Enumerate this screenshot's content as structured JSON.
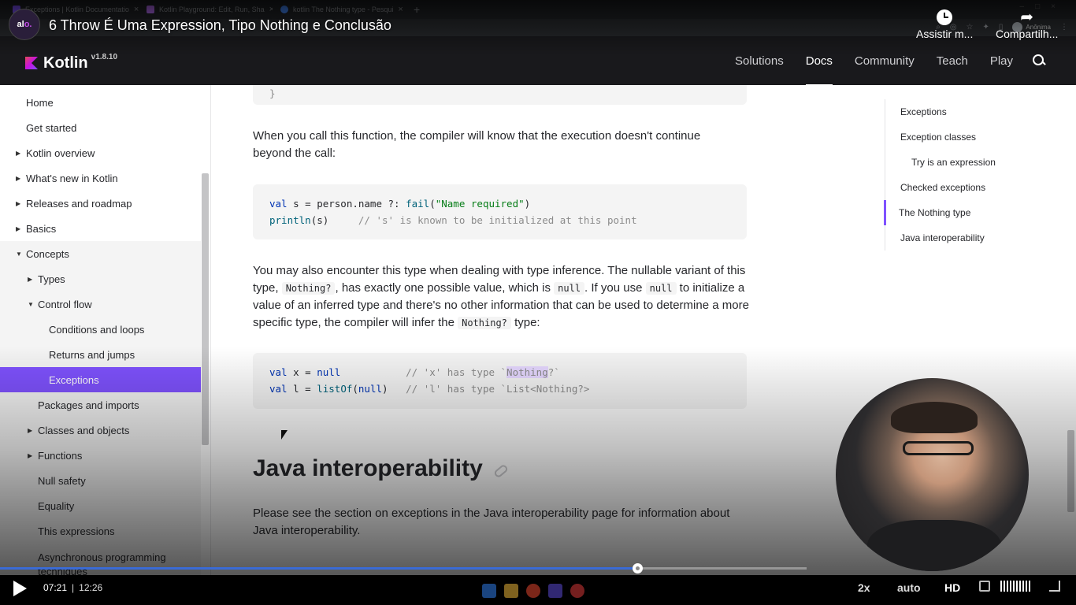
{
  "browser": {
    "tabs": [
      {
        "title": "Exceptions | Kotlin Documentatio",
        "color": "#7f52ff"
      },
      {
        "title": "Kotlin Playground: Edit, Run, Sha",
        "color": "#b36cf0"
      },
      {
        "title": "kotlin The Nothing type - Pesqui",
        "color": "#4285f4"
      }
    ],
    "new_tab": "+",
    "profile_label": "Anônima"
  },
  "kotlin_header": {
    "logo_text": "Kotlin",
    "version": "v1.8.10",
    "nav": [
      "Solutions",
      "Docs",
      "Community",
      "Teach",
      "Play"
    ],
    "active_nav": "Docs"
  },
  "sidebar": {
    "items": [
      {
        "label": "Home",
        "level": 0,
        "arrow": ""
      },
      {
        "label": "Get started",
        "level": 0,
        "arrow": ""
      },
      {
        "label": "Kotlin overview",
        "level": 0,
        "arrow": "▶"
      },
      {
        "label": "What's new in Kotlin",
        "level": 0,
        "arrow": "▶"
      },
      {
        "label": "Releases and roadmap",
        "level": 0,
        "arrow": "▶"
      },
      {
        "label": "Basics",
        "level": 0,
        "arrow": "▶"
      },
      {
        "label": "Concepts",
        "level": 0,
        "arrow": "▼"
      },
      {
        "label": "Types",
        "level": 1,
        "arrow": "▶"
      },
      {
        "label": "Control flow",
        "level": 1,
        "arrow": "▼"
      },
      {
        "label": "Conditions and loops",
        "level": 2,
        "arrow": ""
      },
      {
        "label": "Returns and jumps",
        "level": 2,
        "arrow": ""
      },
      {
        "label": "Exceptions",
        "level": 2,
        "arrow": "",
        "active": true
      },
      {
        "label": "Packages and imports",
        "level": 1,
        "arrow": ""
      },
      {
        "label": "Classes and objects",
        "level": 1,
        "arrow": "▶"
      },
      {
        "label": "Functions",
        "level": 1,
        "arrow": "▶"
      },
      {
        "label": "Null safety",
        "level": 1,
        "arrow": ""
      },
      {
        "label": "Equality",
        "level": 1,
        "arrow": ""
      },
      {
        "label": "This expressions",
        "level": 1,
        "arrow": ""
      },
      {
        "label": "Asynchronous programming techniques",
        "level": 1,
        "arrow": ""
      }
    ]
  },
  "article": {
    "closing_brace": "}",
    "para1": "When you call this function, the compiler will know that the execution doesn't continue beyond the call:",
    "code1": {
      "line1": {
        "kw": "val",
        "mid": " s = person.name ?: ",
        "fn": "fail",
        "open": "(",
        "str": "\"Name required\"",
        "close": ")"
      },
      "line2": {
        "fn": "println",
        "rest": "(s)",
        "comment": "     // 's' is known to be initialized at this point"
      }
    },
    "para2": {
      "t1": "You may also encounter this type when dealing with type inference. The nullable variant of this type, ",
      "c1": "Nothing?",
      "t2": ", has exactly one possible value, which is ",
      "c2": "null",
      "t3": ". If you use ",
      "c3": "null",
      "t4": " to initialize a value of an inferred type and there's no other information that can be used to determine a more specific type, the compiler will infer the ",
      "c4": "Nothing?",
      "t5": " type:"
    },
    "code2": {
      "line1": {
        "kw": "val",
        "mid": " x = ",
        "kw2": "null",
        "comment_a": "           // 'x' has type `",
        "hl": "Nothing",
        "comment_b": "?`"
      },
      "line2": {
        "kw": "val",
        "mid": " l = ",
        "fn": "listOf",
        "open": "(",
        "kw2": "null",
        "close": ")",
        "comment": "   // 'l' has type `List<Nothing?>"
      }
    },
    "heading": "Java interoperability",
    "para3": "Please see the section on exceptions in the Java interoperability page for information about Java interoperability."
  },
  "toc": {
    "items": [
      {
        "label": "Exceptions",
        "sub": false
      },
      {
        "label": "Exception classes",
        "sub": false
      },
      {
        "label": "Try is an expression",
        "sub": true
      },
      {
        "label": "Checked exceptions",
        "sub": false
      },
      {
        "label": "The Nothing type",
        "sub": false,
        "active": true
      },
      {
        "label": "Java interoperability",
        "sub": false
      }
    ]
  },
  "video": {
    "title": "6 Throw É Uma Expression, Tipo Nothing e Conclusão",
    "watch_later": "Assistir m...",
    "share": "Compartilh...",
    "current_time": "07:21",
    "separator": "|",
    "duration": "12:26",
    "progress": 0.79,
    "speed": "2x",
    "quality": "auto",
    "hd": "HD"
  },
  "colors": {
    "accent": "#7f52ff",
    "progress": "#3a6bd6"
  }
}
